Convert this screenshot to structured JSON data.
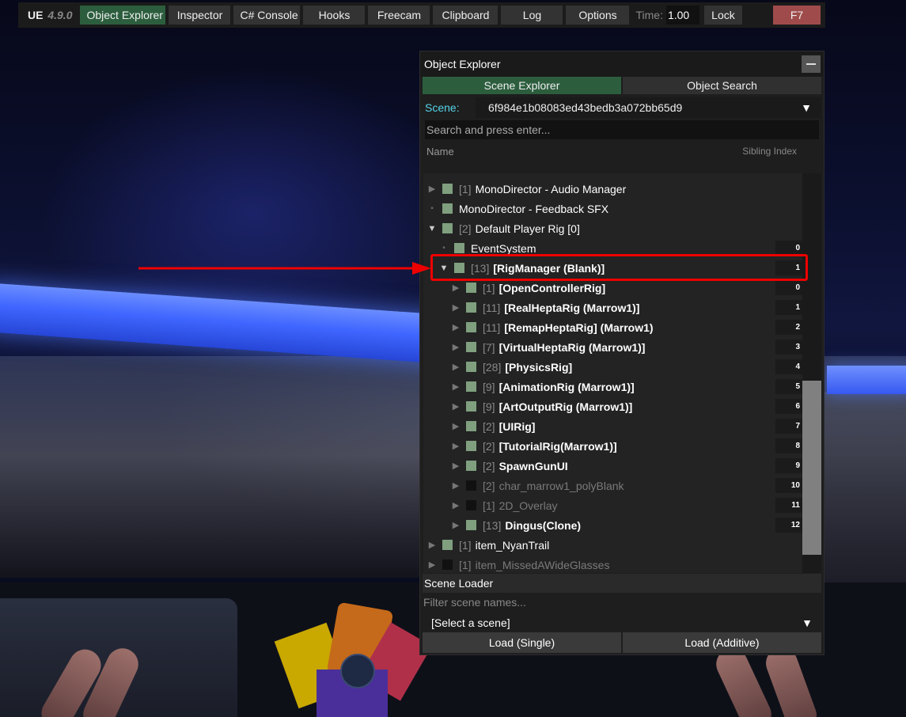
{
  "topbar": {
    "logo": "UE",
    "version": "4.9.0",
    "buttons": [
      "Object Explorer",
      "Inspector",
      "C# Console",
      "Hooks",
      "Freecam",
      "Clipboard",
      "Log",
      "Options"
    ],
    "time_label": "Time:",
    "time_value": "1.00",
    "lock_label": "Lock",
    "f7_label": "F7"
  },
  "panel": {
    "title": "Object Explorer",
    "tabs": [
      "Scene Explorer",
      "Object Search"
    ],
    "scene_label": "Scene:",
    "scene_value": "6f984e1b08083ed43bedb3a072bb65d9",
    "search_placeholder": "Search and press enter...",
    "col_name": "Name",
    "col_sibling": "Sibling Index"
  },
  "tree": [
    {
      "count": "[1]",
      "name": "MonoDirector - Audio Manager",
      "expandable": true,
      "enabled": true
    },
    {
      "count": "",
      "name": "MonoDirector - Feedback SFX",
      "expandable": false,
      "enabled": true
    },
    {
      "count": "[2]",
      "name": "Default Player Rig [0]",
      "expandable": true,
      "expanded": true,
      "enabled": true
    },
    {
      "count": "",
      "name": "EventSystem",
      "expandable": false,
      "enabled": true,
      "index": "0"
    },
    {
      "count": "[13]",
      "name": "[RigManager (Blank)]",
      "expandable": true,
      "expanded": true,
      "enabled": true,
      "index": "1"
    },
    {
      "count": "[1]",
      "name": "[OpenControllerRig]",
      "expandable": true,
      "enabled": true,
      "index": "0"
    },
    {
      "count": "[11]",
      "name": "[RealHeptaRig (Marrow1)]",
      "expandable": true,
      "enabled": true,
      "index": "1"
    },
    {
      "count": "[11]",
      "name": "[RemapHeptaRig] (Marrow1)",
      "expandable": true,
      "enabled": true,
      "index": "2"
    },
    {
      "count": "[7]",
      "name": "[VirtualHeptaRig (Marrow1)]",
      "expandable": true,
      "enabled": true,
      "index": "3"
    },
    {
      "count": "[28]",
      "name": "[PhysicsRig]",
      "expandable": true,
      "enabled": true,
      "index": "4"
    },
    {
      "count": "[9]",
      "name": "[AnimationRig (Marrow1)]",
      "expandable": true,
      "enabled": true,
      "index": "5"
    },
    {
      "count": "[9]",
      "name": "[ArtOutputRig (Marrow1)]",
      "expandable": true,
      "enabled": true,
      "index": "6"
    },
    {
      "count": "[2]",
      "name": "[UIRig]",
      "expandable": true,
      "enabled": true,
      "index": "7"
    },
    {
      "count": "[2]",
      "name": "[TutorialRig(Marrow1)]",
      "expandable": true,
      "enabled": true,
      "index": "8"
    },
    {
      "count": "[2]",
      "name": "SpawnGunUI",
      "expandable": true,
      "enabled": true,
      "index": "9"
    },
    {
      "count": "[2]",
      "name": "char_marrow1_polyBlank",
      "expandable": true,
      "enabled": false,
      "index": "10"
    },
    {
      "count": "[1]",
      "name": "2D_Overlay",
      "expandable": true,
      "enabled": false,
      "index": "11"
    },
    {
      "count": "[13]",
      "name": "Dingus(Clone)",
      "expandable": true,
      "enabled": true,
      "index": "12"
    },
    {
      "count": "[1]",
      "name": "item_NyanTrail",
      "expandable": true,
      "enabled": true
    },
    {
      "count": "[1]",
      "name": "item_MissedAWideGlasses",
      "expandable": true,
      "enabled": false
    }
  ],
  "scrollbar": {
    "position": 0.55
  },
  "loader": {
    "title": "Scene Loader",
    "filter_placeholder": "Filter scene names...",
    "select_value": "[Select a scene]",
    "load_single": "Load (Single)",
    "load_additive": "Load (Additive)"
  },
  "colors": {
    "accent_green": "#2c5e3e",
    "scene_label": "#55d4e8",
    "annotation_red": "#e00000",
    "f7_red": "#a04b4b"
  }
}
